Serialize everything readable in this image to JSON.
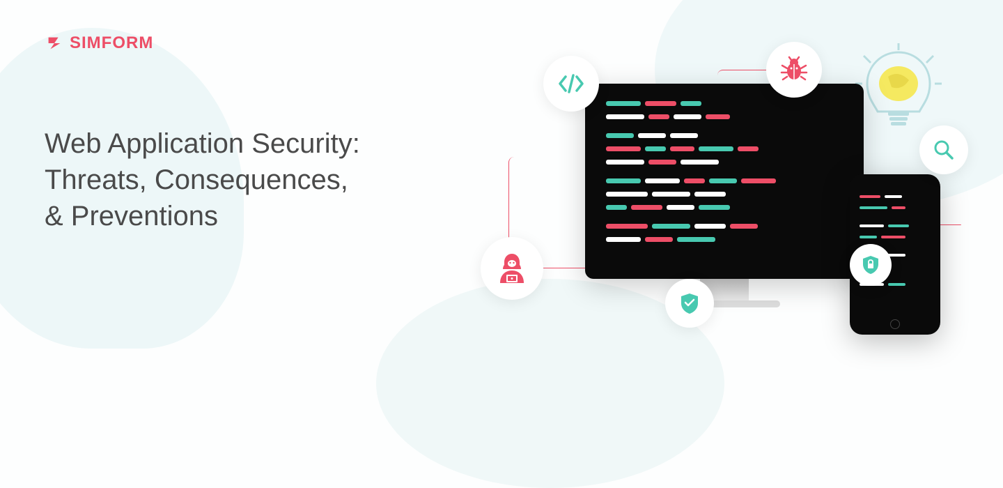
{
  "logo": {
    "text": "SIMFORM",
    "icon": "simform-logo-icon"
  },
  "headline": {
    "line1": "Web Application Security:",
    "line2": "Threats, Consequences,",
    "line3": "& Preventions"
  },
  "icons": {
    "code": "code-brackets-icon",
    "bug": "bug-icon",
    "search": "magnifier-icon",
    "hacker": "hacker-icon",
    "shield_check": "shield-check-icon",
    "shield_lock": "shield-lock-icon",
    "bulb": "lightbulb-icon"
  },
  "colors": {
    "brand": "#ed4e67",
    "accent": "#48c9b0",
    "text": "#4a4a4a",
    "bg_tint": "#e6f4f5"
  }
}
